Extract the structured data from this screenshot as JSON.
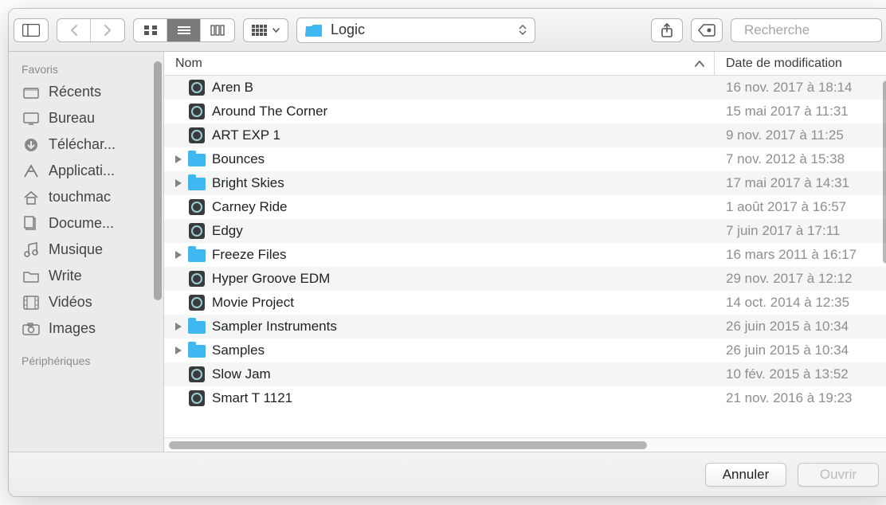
{
  "toolbar": {
    "current_folder": "Logic",
    "search_placeholder": "Recherche"
  },
  "sidebar": {
    "section_favorites": "Favoris",
    "section_devices": "Périphériques",
    "items": [
      "Récents",
      "Bureau",
      "Téléchar...",
      "Applicati...",
      "touchmac",
      "Docume...",
      "Musique",
      "Write",
      "Vidéos",
      "Images"
    ]
  },
  "columns": {
    "name": "Nom",
    "date": "Date de modification"
  },
  "rows": [
    {
      "name": "Aren B",
      "date": "16 nov. 2017 à 18:14",
      "type": "doc",
      "expandable": false
    },
    {
      "name": "Around The Corner",
      "date": "15 mai 2017 à 11:31",
      "type": "doc",
      "expandable": false
    },
    {
      "name": "ART EXP 1",
      "date": "9 nov. 2017 à 11:25",
      "type": "doc",
      "expandable": false
    },
    {
      "name": "Bounces",
      "date": "7 nov. 2012 à 15:38",
      "type": "folder",
      "expandable": true
    },
    {
      "name": "Bright Skies",
      "date": "17 mai 2017 à 14:31",
      "type": "folder",
      "expandable": true
    },
    {
      "name": "Carney Ride",
      "date": "1 août 2017 à 16:57",
      "type": "doc",
      "expandable": false
    },
    {
      "name": "Edgy",
      "date": "7 juin 2017 à 17:11",
      "type": "doc",
      "expandable": false
    },
    {
      "name": "Freeze Files",
      "date": "16 mars 2011 à 16:17",
      "type": "folder",
      "expandable": true
    },
    {
      "name": "Hyper Groove EDM",
      "date": "29 nov. 2017 à 12:12",
      "type": "doc",
      "expandable": false
    },
    {
      "name": "Movie Project",
      "date": "14 oct. 2014 à 12:35",
      "type": "doc",
      "expandable": false
    },
    {
      "name": "Sampler Instruments",
      "date": "26 juin 2015 à 10:34",
      "type": "folder",
      "expandable": true
    },
    {
      "name": "Samples",
      "date": "26 juin 2015 à 10:34",
      "type": "folder",
      "expandable": true
    },
    {
      "name": "Slow Jam",
      "date": "10 fév. 2015 à 13:52",
      "type": "doc",
      "expandable": false
    },
    {
      "name": "Smart T 1121",
      "date": "21 nov. 2016 à 19:23",
      "type": "doc",
      "expandable": false
    }
  ],
  "footer": {
    "cancel": "Annuler",
    "open": "Ouvrir"
  }
}
